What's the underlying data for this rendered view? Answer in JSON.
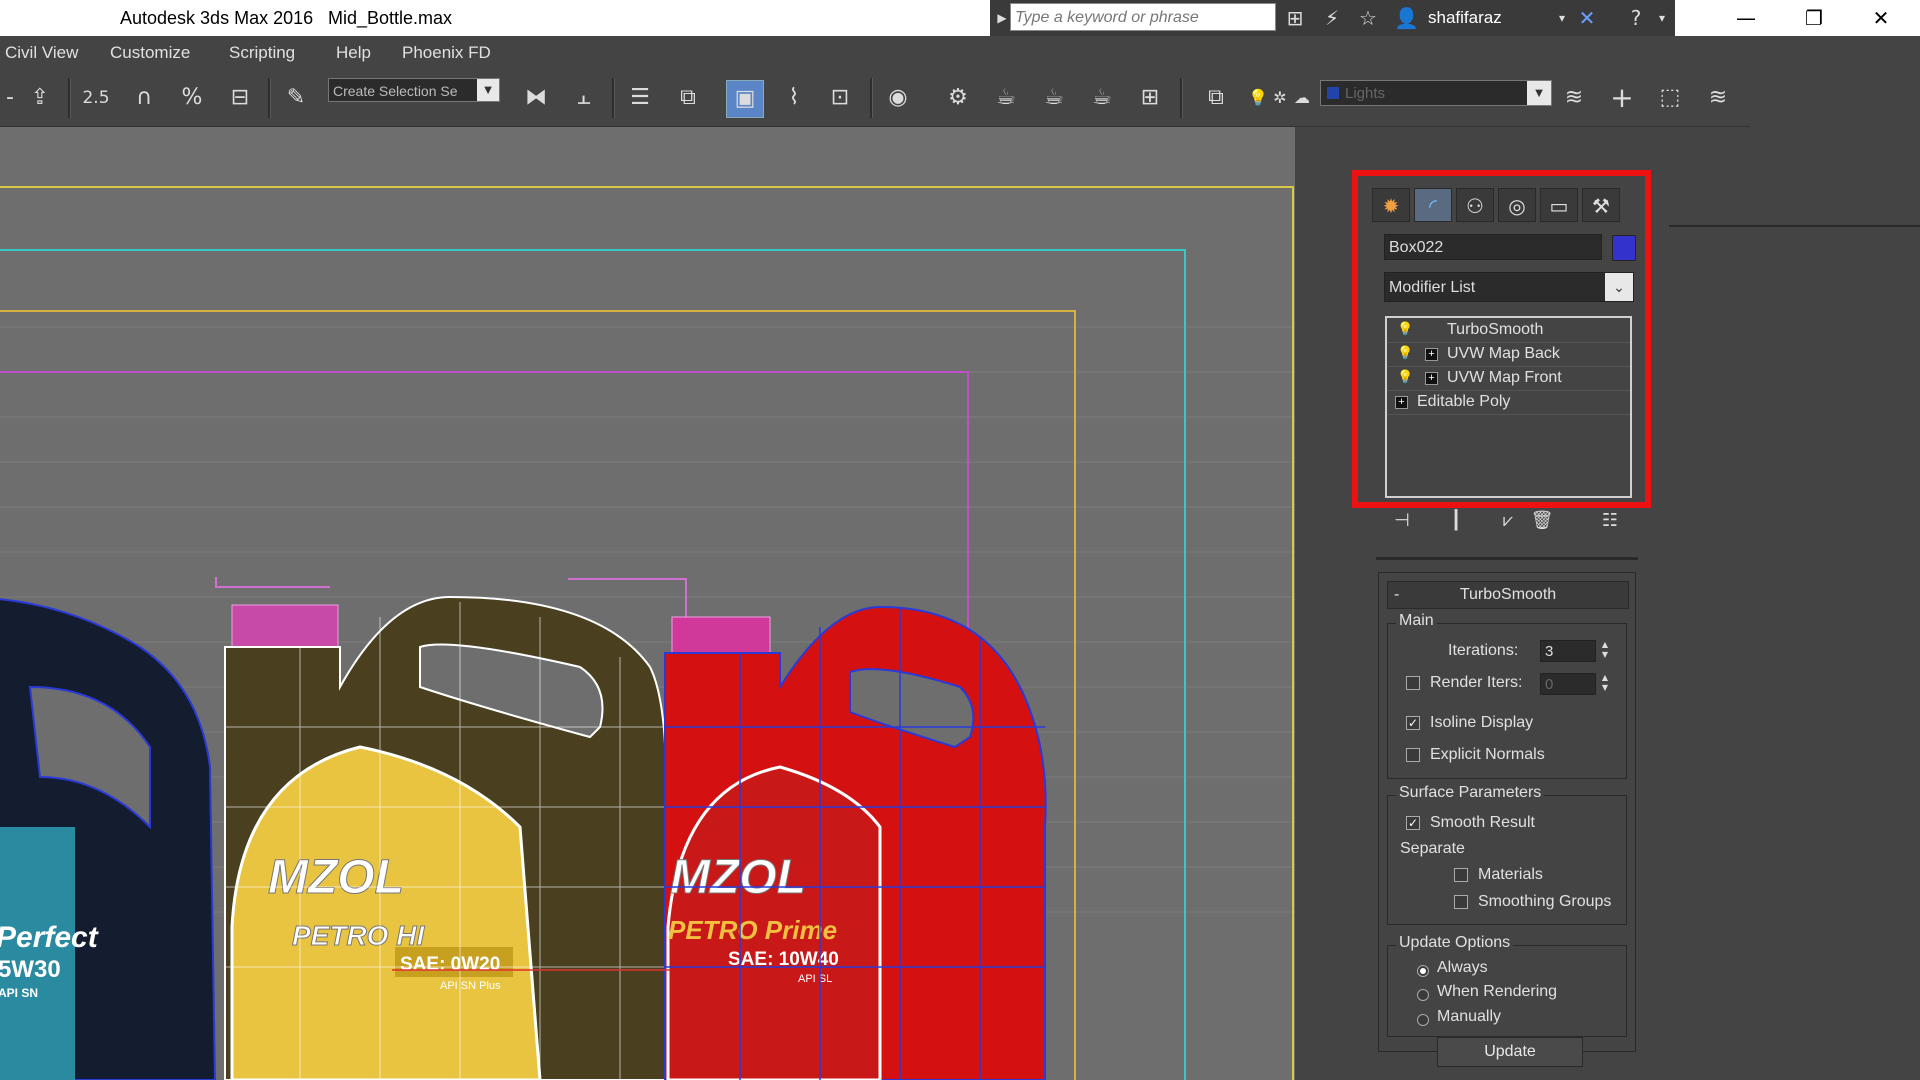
{
  "titlebar": {
    "app_title": "Autodesk 3ds Max 2016",
    "file_name": "Mid_Bottle.max",
    "search_placeholder": "Type a keyword or phrase",
    "username": "shafifaraz"
  },
  "menubar": {
    "items": [
      "Civil View",
      "Customize",
      "Scripting",
      "Help",
      "Phoenix FD"
    ]
  },
  "toolbar": {
    "snap_value": "2.5",
    "selection_set": "Create Selection Se",
    "layer_name": "Lights"
  },
  "command_panel": {
    "object_name": "Box022",
    "object_color": "#3333cc",
    "modifier_list_label": "Modifier List",
    "stack": [
      {
        "label": "TurboSmooth",
        "bulb": true,
        "expandable": false
      },
      {
        "label": "UVW Map Back",
        "bulb": true,
        "expandable": true
      },
      {
        "label": "UVW Map Front",
        "bulb": true,
        "expandable": true
      },
      {
        "label": "Editable Poly",
        "bulb": false,
        "expandable": true
      }
    ],
    "highlight_color": "#ee1111"
  },
  "turbosmooth": {
    "title": "TurboSmooth",
    "collapse_symbol": "-",
    "main_group": "Main",
    "iterations_label": "Iterations:",
    "iterations_value": "3",
    "render_iters_label": "Render Iters:",
    "render_iters_value": "0",
    "render_iters_checked": false,
    "isoline_label": "Isoline Display",
    "isoline_checked": true,
    "explicit_normals_label": "Explicit Normals",
    "explicit_normals_checked": false,
    "surface_group": "Surface Parameters",
    "smooth_result_label": "Smooth Result",
    "smooth_result_checked": true,
    "separate_label": "Separate",
    "materials_label": "Materials",
    "materials_checked": false,
    "smoothing_groups_label": "Smoothing Groups",
    "smoothing_groups_checked": false,
    "update_group": "Update Options",
    "update_options": [
      "Always",
      "When Rendering",
      "Manually"
    ],
    "update_selected": "Always",
    "update_button": "Update"
  },
  "viewport": {
    "bottle_labels": [
      {
        "brand": "MZOL",
        "product": "PETRO HI",
        "grade": "SAE: 0W20",
        "spec": "API SN Plus"
      },
      {
        "brand": "MZOL",
        "product": "PETRO Prime",
        "grade": "SAE: 10W40",
        "spec": "API SL"
      },
      {
        "product": "Perfect",
        "grade": "5W30",
        "spec": "API SN"
      }
    ]
  }
}
